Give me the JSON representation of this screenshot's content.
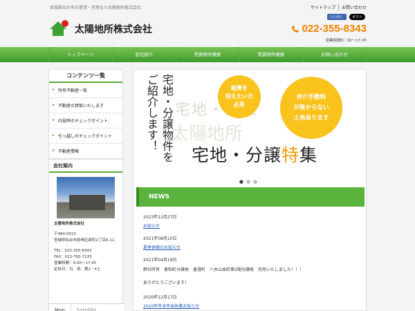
{
  "header": {
    "tagline": "宮城県仙台市の賃貸・売買なら太陽地所株式会社",
    "top_links": [
      "サイトマップ",
      "お問い合わせ"
    ],
    "fb_label": "いいね！",
    "x_label": "ポスト",
    "company_name": "太陽地所株式会社",
    "phone": "022-355-8343",
    "hours": "営業時間9：00～17:45"
  },
  "nav": {
    "items": [
      "トップページ",
      "会社紹介",
      "売買物件検索",
      "賃貸物件検索",
      "お問い合わせ"
    ]
  },
  "sidebar": {
    "contents_title": "コンテンツ一覧",
    "items": [
      "所有不動産一覧",
      "不動産の買取いたします",
      "内見時のチェックポイント",
      "引っ越しのチェックポイント",
      "不動産情報"
    ],
    "company_title": "会社案内",
    "company_name": "太陽地所株式会社",
    "postal": "〒984-0015",
    "address": "宮城県仙台市若林区卸町2丁目6-11",
    "tel": "TEL：022-355-8343",
    "fax": "FAX：022-782-7133",
    "hours": "営業時間：9:00～17:45",
    "holidays": "定休日：日、祝、第2・4土",
    "map_tabs": [
      "Map",
      "Satellite"
    ]
  },
  "banner": {
    "vertical_1": "宅地・分譲物件を",
    "vertical_2": "ご紹介します！",
    "circle_1": [
      "経費を",
      "抑えたい方",
      "必見"
    ],
    "circle_2": [
      "仲介手数料",
      "が掛からない",
      "土地あります"
    ],
    "headline_pre": "宅地・分譲",
    "headline_hl": "特",
    "headline_post": "集"
  },
  "news": {
    "title": "NEWS",
    "items": [
      {
        "date": "2023年12月27日",
        "link": "お知らせ"
      },
      {
        "date": "2021年08月10日",
        "link": "夏季休暇のお知らせ"
      },
      {
        "date": "2021年04月19日",
        "body": "弊社所有　恵和町分譲地　香澄町　八木山本町第2期分譲地　完売いたしました！！！",
        "body2": "ありがとうございます！"
      },
      {
        "date": "2020年12月17日",
        "link": "2020年年末年始休業お知らせ"
      }
    ]
  },
  "colors": {
    "accent_green": "#5ab33c",
    "phone_orange": "#f08200",
    "circle_yellow": "#f9c21c",
    "link_blue": "#1a55b5"
  },
  "icons": [
    "house-logo-icon",
    "phone-icon"
  ]
}
